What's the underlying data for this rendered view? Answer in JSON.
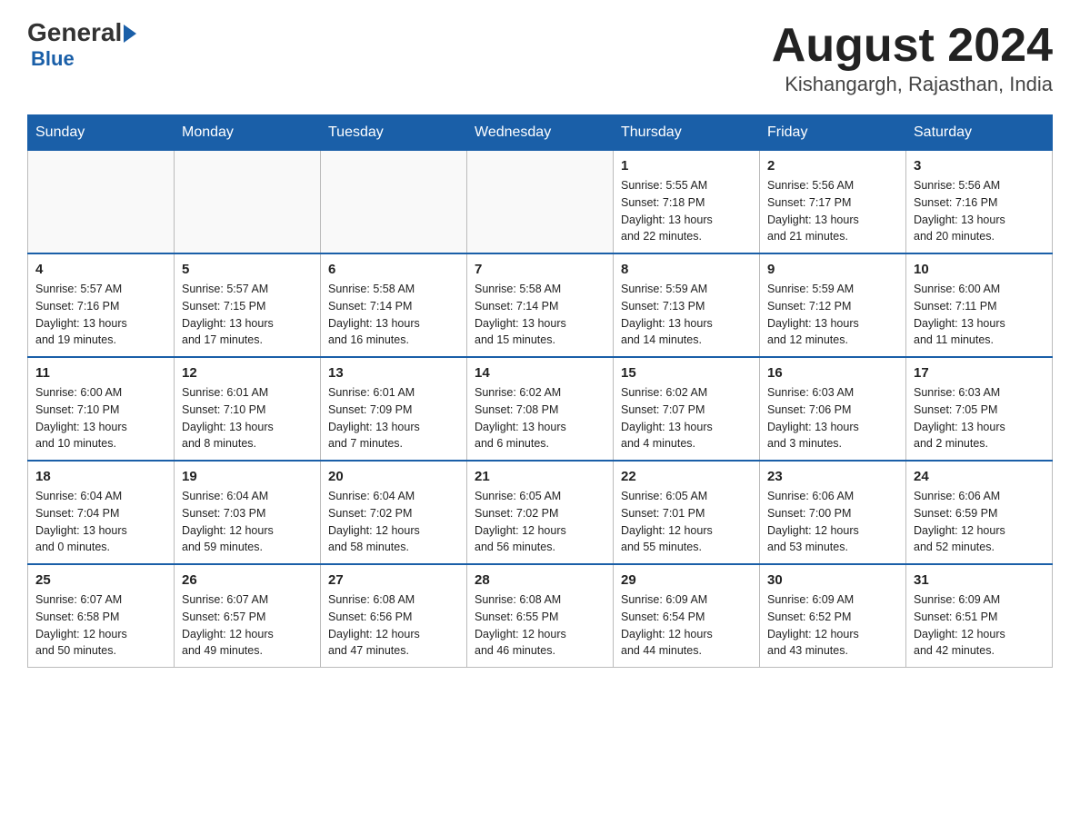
{
  "header": {
    "logo_general": "General",
    "logo_blue": "Blue",
    "month_title": "August 2024",
    "location": "Kishangargh, Rajasthan, India"
  },
  "days_of_week": [
    "Sunday",
    "Monday",
    "Tuesday",
    "Wednesday",
    "Thursday",
    "Friday",
    "Saturday"
  ],
  "weeks": [
    [
      {
        "day": "",
        "info": ""
      },
      {
        "day": "",
        "info": ""
      },
      {
        "day": "",
        "info": ""
      },
      {
        "day": "",
        "info": ""
      },
      {
        "day": "1",
        "info": "Sunrise: 5:55 AM\nSunset: 7:18 PM\nDaylight: 13 hours\nand 22 minutes."
      },
      {
        "day": "2",
        "info": "Sunrise: 5:56 AM\nSunset: 7:17 PM\nDaylight: 13 hours\nand 21 minutes."
      },
      {
        "day": "3",
        "info": "Sunrise: 5:56 AM\nSunset: 7:16 PM\nDaylight: 13 hours\nand 20 minutes."
      }
    ],
    [
      {
        "day": "4",
        "info": "Sunrise: 5:57 AM\nSunset: 7:16 PM\nDaylight: 13 hours\nand 19 minutes."
      },
      {
        "day": "5",
        "info": "Sunrise: 5:57 AM\nSunset: 7:15 PM\nDaylight: 13 hours\nand 17 minutes."
      },
      {
        "day": "6",
        "info": "Sunrise: 5:58 AM\nSunset: 7:14 PM\nDaylight: 13 hours\nand 16 minutes."
      },
      {
        "day": "7",
        "info": "Sunrise: 5:58 AM\nSunset: 7:14 PM\nDaylight: 13 hours\nand 15 minutes."
      },
      {
        "day": "8",
        "info": "Sunrise: 5:59 AM\nSunset: 7:13 PM\nDaylight: 13 hours\nand 14 minutes."
      },
      {
        "day": "9",
        "info": "Sunrise: 5:59 AM\nSunset: 7:12 PM\nDaylight: 13 hours\nand 12 minutes."
      },
      {
        "day": "10",
        "info": "Sunrise: 6:00 AM\nSunset: 7:11 PM\nDaylight: 13 hours\nand 11 minutes."
      }
    ],
    [
      {
        "day": "11",
        "info": "Sunrise: 6:00 AM\nSunset: 7:10 PM\nDaylight: 13 hours\nand 10 minutes."
      },
      {
        "day": "12",
        "info": "Sunrise: 6:01 AM\nSunset: 7:10 PM\nDaylight: 13 hours\nand 8 minutes."
      },
      {
        "day": "13",
        "info": "Sunrise: 6:01 AM\nSunset: 7:09 PM\nDaylight: 13 hours\nand 7 minutes."
      },
      {
        "day": "14",
        "info": "Sunrise: 6:02 AM\nSunset: 7:08 PM\nDaylight: 13 hours\nand 6 minutes."
      },
      {
        "day": "15",
        "info": "Sunrise: 6:02 AM\nSunset: 7:07 PM\nDaylight: 13 hours\nand 4 minutes."
      },
      {
        "day": "16",
        "info": "Sunrise: 6:03 AM\nSunset: 7:06 PM\nDaylight: 13 hours\nand 3 minutes."
      },
      {
        "day": "17",
        "info": "Sunrise: 6:03 AM\nSunset: 7:05 PM\nDaylight: 13 hours\nand 2 minutes."
      }
    ],
    [
      {
        "day": "18",
        "info": "Sunrise: 6:04 AM\nSunset: 7:04 PM\nDaylight: 13 hours\nand 0 minutes."
      },
      {
        "day": "19",
        "info": "Sunrise: 6:04 AM\nSunset: 7:03 PM\nDaylight: 12 hours\nand 59 minutes."
      },
      {
        "day": "20",
        "info": "Sunrise: 6:04 AM\nSunset: 7:02 PM\nDaylight: 12 hours\nand 58 minutes."
      },
      {
        "day": "21",
        "info": "Sunrise: 6:05 AM\nSunset: 7:02 PM\nDaylight: 12 hours\nand 56 minutes."
      },
      {
        "day": "22",
        "info": "Sunrise: 6:05 AM\nSunset: 7:01 PM\nDaylight: 12 hours\nand 55 minutes."
      },
      {
        "day": "23",
        "info": "Sunrise: 6:06 AM\nSunset: 7:00 PM\nDaylight: 12 hours\nand 53 minutes."
      },
      {
        "day": "24",
        "info": "Sunrise: 6:06 AM\nSunset: 6:59 PM\nDaylight: 12 hours\nand 52 minutes."
      }
    ],
    [
      {
        "day": "25",
        "info": "Sunrise: 6:07 AM\nSunset: 6:58 PM\nDaylight: 12 hours\nand 50 minutes."
      },
      {
        "day": "26",
        "info": "Sunrise: 6:07 AM\nSunset: 6:57 PM\nDaylight: 12 hours\nand 49 minutes."
      },
      {
        "day": "27",
        "info": "Sunrise: 6:08 AM\nSunset: 6:56 PM\nDaylight: 12 hours\nand 47 minutes."
      },
      {
        "day": "28",
        "info": "Sunrise: 6:08 AM\nSunset: 6:55 PM\nDaylight: 12 hours\nand 46 minutes."
      },
      {
        "day": "29",
        "info": "Sunrise: 6:09 AM\nSunset: 6:54 PM\nDaylight: 12 hours\nand 44 minutes."
      },
      {
        "day": "30",
        "info": "Sunrise: 6:09 AM\nSunset: 6:52 PM\nDaylight: 12 hours\nand 43 minutes."
      },
      {
        "day": "31",
        "info": "Sunrise: 6:09 AM\nSunset: 6:51 PM\nDaylight: 12 hours\nand 42 minutes."
      }
    ]
  ]
}
